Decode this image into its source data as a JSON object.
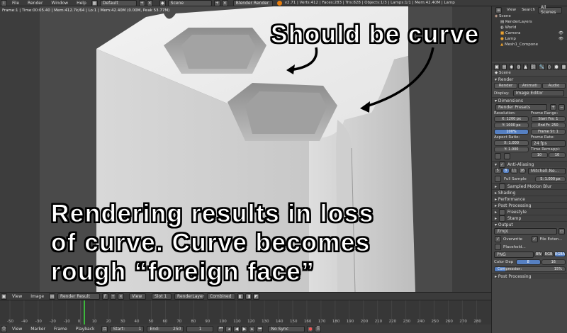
{
  "top_bar": {
    "menus": [
      "File",
      "Render",
      "Window",
      "Help"
    ],
    "layout": "Default",
    "scene": "Scene",
    "engine": "Blender Render",
    "stats": "v2.71 | Verts:412 | Faces:283 | Tris:828 | Objects:1/3 | Lamps:1/1 | Mem:42.40M | Lamp"
  },
  "render_view": {
    "info": "Frame:1 | Time:00:05.40 | Mem:412.7k/64 | Lo:1 | Mem:42.40M (0.00M, Peak 53.77M)"
  },
  "captions": {
    "top": "Should be curve",
    "bottom": "Rendering results in loss of curve. Curve becomes rough “foreign face”"
  },
  "outliner": {
    "tabs": [
      "View",
      "Search",
      "All Scenes"
    ],
    "items": [
      "Scene",
      "RenderLayers",
      "World",
      "Camera",
      "Lamp",
      "Mesh1_Compone"
    ]
  },
  "properties": {
    "breadcrumb": "Scene",
    "render_header": "Render",
    "render_buttons": [
      "Render",
      "Animati",
      "Audio"
    ],
    "display_label": "Display:",
    "display_value": "Image Editor",
    "dimensions": "Dimensions",
    "render_presets": "Render Presets",
    "resolution_label": "Resolution:",
    "res_x": "X: 1200 px",
    "res_y": "Y: 1000 px",
    "res_pct": "100%",
    "frame_range_label": "Frame Range:",
    "start_frame": "Start Fra: 1",
    "end_frame": "End Fr: 250",
    "frame_step": "Frame St: 1",
    "aspect_label": "Aspect Ratio:",
    "aspect_x": "X: 1.000",
    "aspect_y": "Y: 1.000",
    "frame_rate_label": "Frame Rate:",
    "frame_rate": "24 fps",
    "time_remap_label": "Time Remappi:",
    "time_remap_old": "10",
    "time_remap_new": "10",
    "anti_aliasing": "Anti-Aliasing",
    "aa_samples": [
      "5",
      "8",
      "11",
      "16"
    ],
    "aa_filter": "Mitchell-Ne...",
    "full_sample": "Full Sample",
    "filter_size": "S: 1.000 px",
    "collapsed": [
      "Sampled Motion Blur",
      "Shading",
      "Performance",
      "Post Processing",
      "Freestyle",
      "Stamp",
      "Output"
    ],
    "output_path": "/tmp\\",
    "overwrite": "Overwrite",
    "file_ext": "File Exten...",
    "placeholders": "Placehold...",
    "format": "PNG",
    "color_modes": [
      "BW",
      "RGB",
      "RGBA"
    ],
    "color_depth_label": "Color Dep",
    "color_depths": [
      "8",
      "16"
    ],
    "compression_label": "Compression:",
    "compression": "15%",
    "post_processing_bottom": "Post Processing"
  },
  "image_editor": {
    "menus": [
      "View",
      "Image"
    ],
    "image": "Render Result",
    "slot": "Slot 1",
    "layer": "RenderLayer",
    "pass": "Combined"
  },
  "timeline": {
    "ticks": [
      "-50",
      "-40",
      "-30",
      "-20",
      "-10",
      "0",
      "10",
      "20",
      "30",
      "40",
      "50",
      "60",
      "70",
      "80",
      "90",
      "100",
      "110",
      "120",
      "130",
      "140",
      "150",
      "160",
      "170",
      "180",
      "190",
      "200",
      "210",
      "220",
      "230",
      "240",
      "250",
      "260",
      "270",
      "280"
    ],
    "current": 1,
    "menus": [
      "View",
      "Marker",
      "Frame",
      "Playback"
    ],
    "start": "Start:",
    "start_val": "1",
    "end": "End:",
    "end_val": "250",
    "frame_val": "1",
    "sync": "No Sync"
  }
}
